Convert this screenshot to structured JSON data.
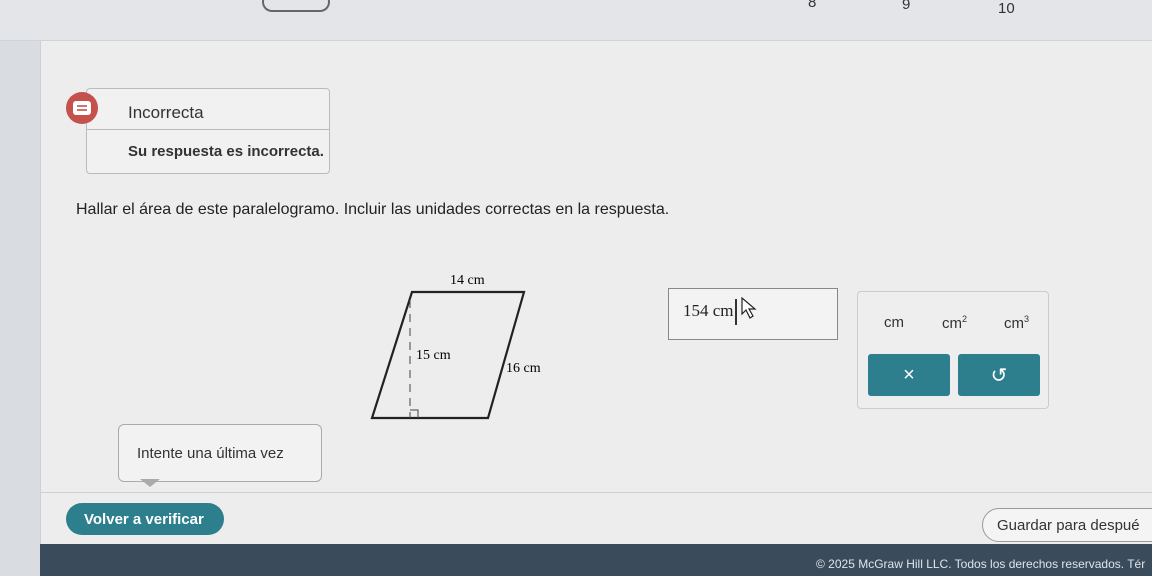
{
  "progress": {
    "steps": [
      "8",
      "9",
      "10"
    ]
  },
  "feedback": {
    "title": "Incorrecta",
    "body": "Su respuesta es incorrecta."
  },
  "question": {
    "text": "Hallar el área de este paralelogramo. Incluir las unidades correctas en la respuesta."
  },
  "figure": {
    "top_label": "14 cm",
    "height_label": "15 cm",
    "side_label": "16 cm"
  },
  "answer": {
    "value": "154 cm"
  },
  "units": {
    "cm": "cm",
    "cm2_base": "cm",
    "cm2_exp": "2",
    "cm3_base": "cm",
    "cm3_exp": "3"
  },
  "pad": {
    "clear_symbol": "×",
    "undo_symbol": "↺"
  },
  "hint": {
    "text": "Intente una última vez"
  },
  "actions": {
    "verify": "Volver a verificar",
    "save": "Guardar para despué"
  },
  "footer": {
    "text": "© 2025 McGraw Hill LLC. Todos los derechos reservados.   Tér"
  },
  "colors": {
    "accent": "#2d7f8e",
    "error": "#c4514b"
  }
}
